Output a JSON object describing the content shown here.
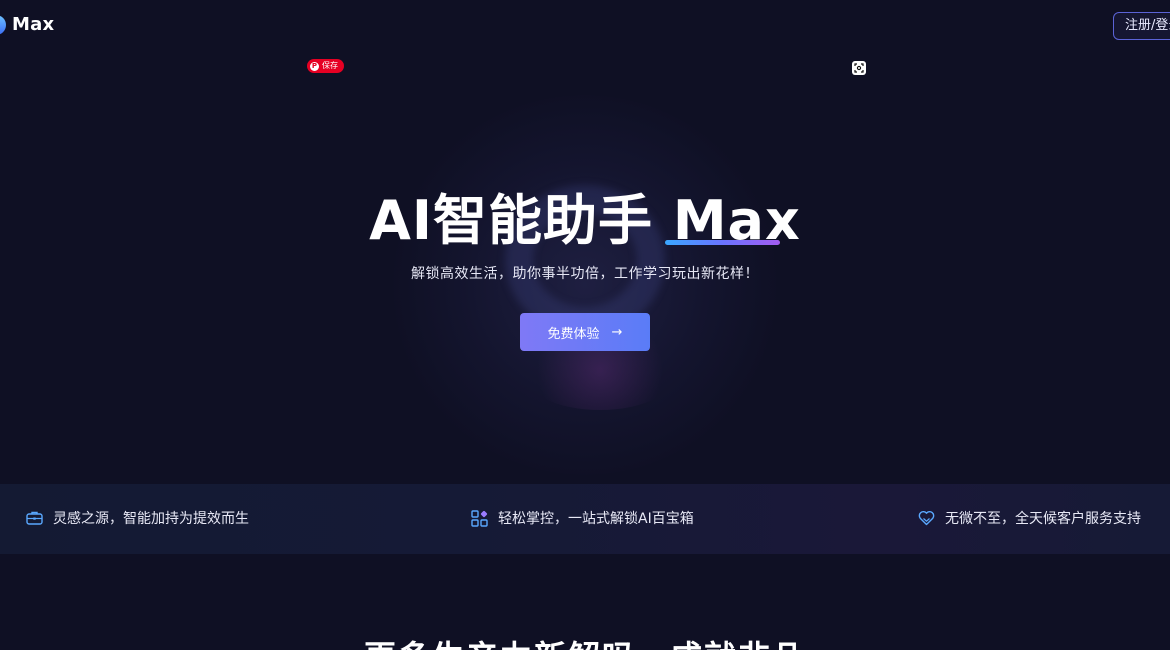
{
  "header": {
    "logo_text": "Max",
    "login_label": "注册/登录"
  },
  "overlays": {
    "pin_save_label": "保存",
    "pin_icon": "pinterest-icon",
    "lens_icon": "visual-search-icon"
  },
  "hero": {
    "title": "AI智能助手 Max",
    "subtitle": "解锁高效生活，助你事半功倍，工作学习玩出新花样！",
    "cta_label": "免费体验",
    "cta_arrow": "→"
  },
  "features": [
    {
      "icon": "briefcase-icon",
      "label": "灵感之源，智能加持为提效而生"
    },
    {
      "icon": "apps-grid-icon",
      "label": "轻松掌控，一站式解锁AI百宝箱"
    },
    {
      "icon": "heart-support-icon",
      "label": "无微不至，全天候客户服务支持"
    }
  ],
  "section": {
    "heading": "更多生产力新解吗，成就非凡"
  },
  "colors": {
    "background": "#0f1024",
    "accent": "#6a7cf7",
    "border_accent": "#5b63d6"
  }
}
